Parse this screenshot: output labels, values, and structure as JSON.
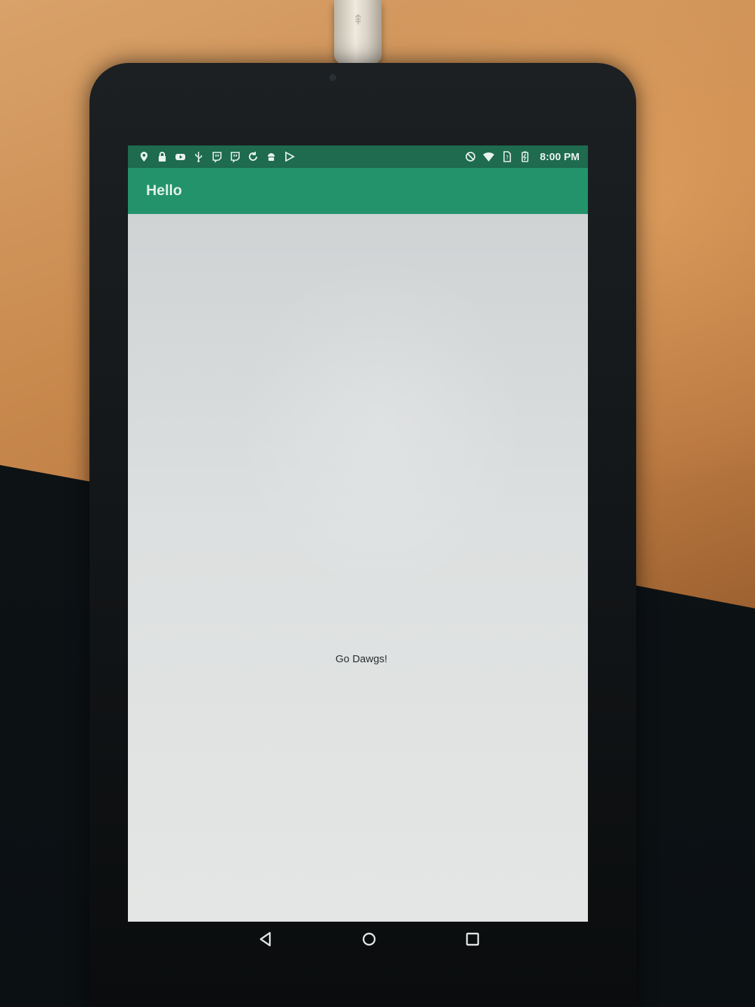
{
  "app": {
    "title": "Hello",
    "message": "Go Dawgs!"
  },
  "status_bar": {
    "time": "8:00 PM",
    "left_icons": [
      "location-pin-icon",
      "lock-icon",
      "video-icon",
      "usb-icon",
      "twitch-icon",
      "twitch-icon",
      "circular-arrow-icon",
      "android-icon",
      "play-store-icon"
    ],
    "right_icons": [
      "do-not-disturb-icon",
      "wifi-icon",
      "no-sim-icon",
      "battery-icon"
    ]
  },
  "navigation": {
    "buttons": [
      "back-icon",
      "home-icon",
      "recents-icon"
    ]
  },
  "colors": {
    "status_bar": "#1e6b4f",
    "app_bar": "#23936b",
    "screen_background": "#d6dadb",
    "text": "#2b2d2e"
  }
}
